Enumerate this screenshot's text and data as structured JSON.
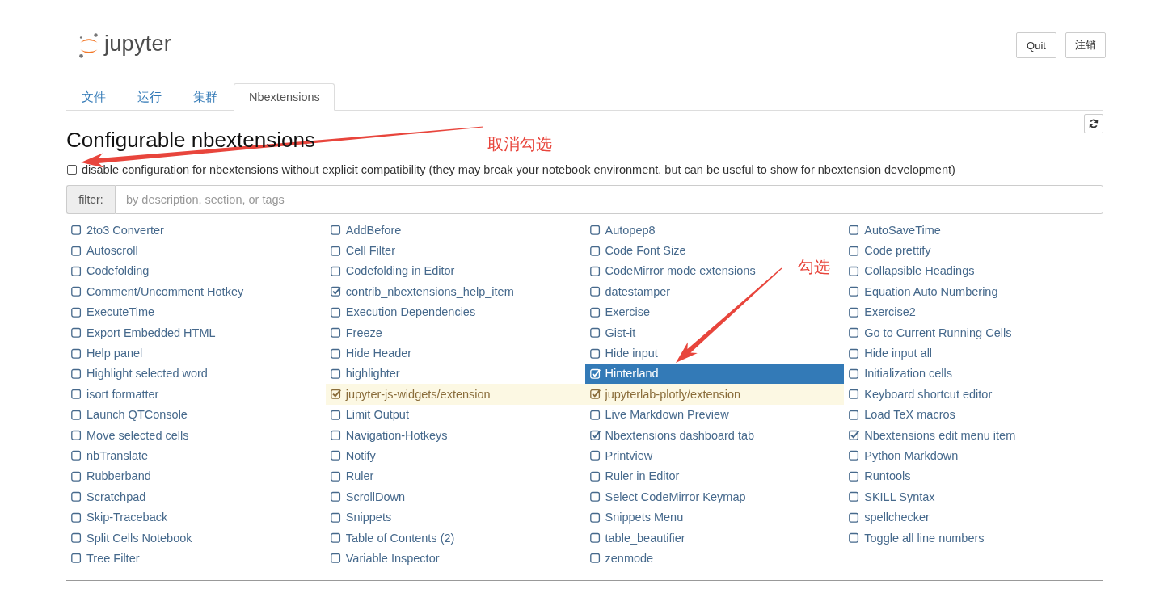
{
  "header": {
    "logo_text": "jupyter",
    "buttons": [
      {
        "label": "Quit"
      },
      {
        "label": "注销"
      }
    ]
  },
  "tabs": [
    {
      "label": "文件",
      "selected": false
    },
    {
      "label": "运行",
      "selected": false
    },
    {
      "label": "集群",
      "selected": false
    },
    {
      "label": "Nbextensions",
      "selected": true
    }
  ],
  "page": {
    "title": "Configurable nbextensions",
    "compat_option": {
      "checked": false,
      "label": "disable configuration for nbextensions without explicit compatibility (they may break your notebook environment, but can be useful to show for nbextension development)"
    },
    "filter": {
      "label": "filter:",
      "placeholder": "by description, section, or tags"
    }
  },
  "extensions": [
    {
      "items": [
        {
          "name": "2to3 Converter",
          "checked": false,
          "selected": false,
          "highlighted": false
        },
        {
          "name": "Autoscroll",
          "checked": false,
          "selected": false,
          "highlighted": false
        },
        {
          "name": "Codefolding",
          "checked": false,
          "selected": false,
          "highlighted": false
        },
        {
          "name": "Comment/Uncomment Hotkey",
          "checked": false,
          "selected": false,
          "highlighted": false
        },
        {
          "name": "ExecuteTime",
          "checked": false,
          "selected": false,
          "highlighted": false
        },
        {
          "name": "Export Embedded HTML",
          "checked": false,
          "selected": false,
          "highlighted": false
        },
        {
          "name": "Help panel",
          "checked": false,
          "selected": false,
          "highlighted": false
        },
        {
          "name": "Highlight selected word",
          "checked": false,
          "selected": false,
          "highlighted": false
        },
        {
          "name": "isort formatter",
          "checked": false,
          "selected": false,
          "highlighted": false
        },
        {
          "name": "Launch QTConsole",
          "checked": false,
          "selected": false,
          "highlighted": false
        },
        {
          "name": "Move selected cells",
          "checked": false,
          "selected": false,
          "highlighted": false
        },
        {
          "name": "nbTranslate",
          "checked": false,
          "selected": false,
          "highlighted": false
        },
        {
          "name": "Rubberband",
          "checked": false,
          "selected": false,
          "highlighted": false
        },
        {
          "name": "Scratchpad",
          "checked": false,
          "selected": false,
          "highlighted": false
        },
        {
          "name": "Skip-Traceback",
          "checked": false,
          "selected": false,
          "highlighted": false
        },
        {
          "name": "Split Cells Notebook",
          "checked": false,
          "selected": false,
          "highlighted": false
        },
        {
          "name": "Tree Filter",
          "checked": false,
          "selected": false,
          "highlighted": false
        }
      ]
    },
    {
      "items": [
        {
          "name": "AddBefore",
          "checked": false,
          "selected": false,
          "highlighted": false
        },
        {
          "name": "Cell Filter",
          "checked": false,
          "selected": false,
          "highlighted": false
        },
        {
          "name": "Codefolding in Editor",
          "checked": false,
          "selected": false,
          "highlighted": false
        },
        {
          "name": "contrib_nbextensions_help_item",
          "checked": true,
          "selected": false,
          "highlighted": false
        },
        {
          "name": "Execution Dependencies",
          "checked": false,
          "selected": false,
          "highlighted": false
        },
        {
          "name": "Freeze",
          "checked": false,
          "selected": false,
          "highlighted": false
        },
        {
          "name": "Hide Header",
          "checked": false,
          "selected": false,
          "highlighted": false
        },
        {
          "name": "highlighter",
          "checked": false,
          "selected": false,
          "highlighted": false
        },
        {
          "name": "jupyter-js-widgets/extension",
          "checked": true,
          "selected": false,
          "highlighted": true
        },
        {
          "name": "Limit Output",
          "checked": false,
          "selected": false,
          "highlighted": false
        },
        {
          "name": "Navigation-Hotkeys",
          "checked": false,
          "selected": false,
          "highlighted": false
        },
        {
          "name": "Notify",
          "checked": false,
          "selected": false,
          "highlighted": false
        },
        {
          "name": "Ruler",
          "checked": false,
          "selected": false,
          "highlighted": false
        },
        {
          "name": "ScrollDown",
          "checked": false,
          "selected": false,
          "highlighted": false
        },
        {
          "name": "Snippets",
          "checked": false,
          "selected": false,
          "highlighted": false
        },
        {
          "name": "Table of Contents (2)",
          "checked": false,
          "selected": false,
          "highlighted": false
        },
        {
          "name": "Variable Inspector",
          "checked": false,
          "selected": false,
          "highlighted": false
        }
      ]
    },
    {
      "items": [
        {
          "name": "Autopep8",
          "checked": false,
          "selected": false,
          "highlighted": false
        },
        {
          "name": "Code Font Size",
          "checked": false,
          "selected": false,
          "highlighted": false
        },
        {
          "name": "CodeMirror mode extensions",
          "checked": false,
          "selected": false,
          "highlighted": false
        },
        {
          "name": "datestamper",
          "checked": false,
          "selected": false,
          "highlighted": false
        },
        {
          "name": "Exercise",
          "checked": false,
          "selected": false,
          "highlighted": false
        },
        {
          "name": "Gist-it",
          "checked": false,
          "selected": false,
          "highlighted": false
        },
        {
          "name": "Hide input",
          "checked": false,
          "selected": false,
          "highlighted": false
        },
        {
          "name": "Hinterland",
          "checked": true,
          "selected": true,
          "highlighted": false
        },
        {
          "name": "jupyterlab-plotly/extension",
          "checked": true,
          "selected": false,
          "highlighted": true
        },
        {
          "name": "Live Markdown Preview",
          "checked": false,
          "selected": false,
          "highlighted": false
        },
        {
          "name": "Nbextensions dashboard tab",
          "checked": true,
          "selected": false,
          "highlighted": false
        },
        {
          "name": "Printview",
          "checked": false,
          "selected": false,
          "highlighted": false
        },
        {
          "name": "Ruler in Editor",
          "checked": false,
          "selected": false,
          "highlighted": false
        },
        {
          "name": "Select CodeMirror Keymap",
          "checked": false,
          "selected": false,
          "highlighted": false
        },
        {
          "name": "Snippets Menu",
          "checked": false,
          "selected": false,
          "highlighted": false
        },
        {
          "name": "table_beautifier",
          "checked": false,
          "selected": false,
          "highlighted": false
        },
        {
          "name": "zenmode",
          "checked": false,
          "selected": false,
          "highlighted": false
        }
      ]
    },
    {
      "items": [
        {
          "name": "AutoSaveTime",
          "checked": false,
          "selected": false,
          "highlighted": false
        },
        {
          "name": "Code prettify",
          "checked": false,
          "selected": false,
          "highlighted": false
        },
        {
          "name": "Collapsible Headings",
          "checked": false,
          "selected": false,
          "highlighted": false
        },
        {
          "name": "Equation Auto Numbering",
          "checked": false,
          "selected": false,
          "highlighted": false
        },
        {
          "name": "Exercise2",
          "checked": false,
          "selected": false,
          "highlighted": false
        },
        {
          "name": "Go to Current Running Cells",
          "checked": false,
          "selected": false,
          "highlighted": false
        },
        {
          "name": "Hide input all",
          "checked": false,
          "selected": false,
          "highlighted": false
        },
        {
          "name": "Initialization cells",
          "checked": false,
          "selected": false,
          "highlighted": false
        },
        {
          "name": "Keyboard shortcut editor",
          "checked": false,
          "selected": false,
          "highlighted": false
        },
        {
          "name": "Load TeX macros",
          "checked": false,
          "selected": false,
          "highlighted": false
        },
        {
          "name": "Nbextensions edit menu item",
          "checked": true,
          "selected": false,
          "highlighted": false
        },
        {
          "name": "Python Markdown",
          "checked": false,
          "selected": false,
          "highlighted": false
        },
        {
          "name": "Runtools",
          "checked": false,
          "selected": false,
          "highlighted": false
        },
        {
          "name": "SKILL Syntax",
          "checked": false,
          "selected": false,
          "highlighted": false
        },
        {
          "name": "spellchecker",
          "checked": false,
          "selected": false,
          "highlighted": false
        },
        {
          "name": "Toggle all line numbers",
          "checked": false,
          "selected": false,
          "highlighted": false
        }
      ]
    }
  ],
  "annotations": [
    {
      "text": "取消勾选"
    },
    {
      "text": "勾选"
    }
  ]
}
